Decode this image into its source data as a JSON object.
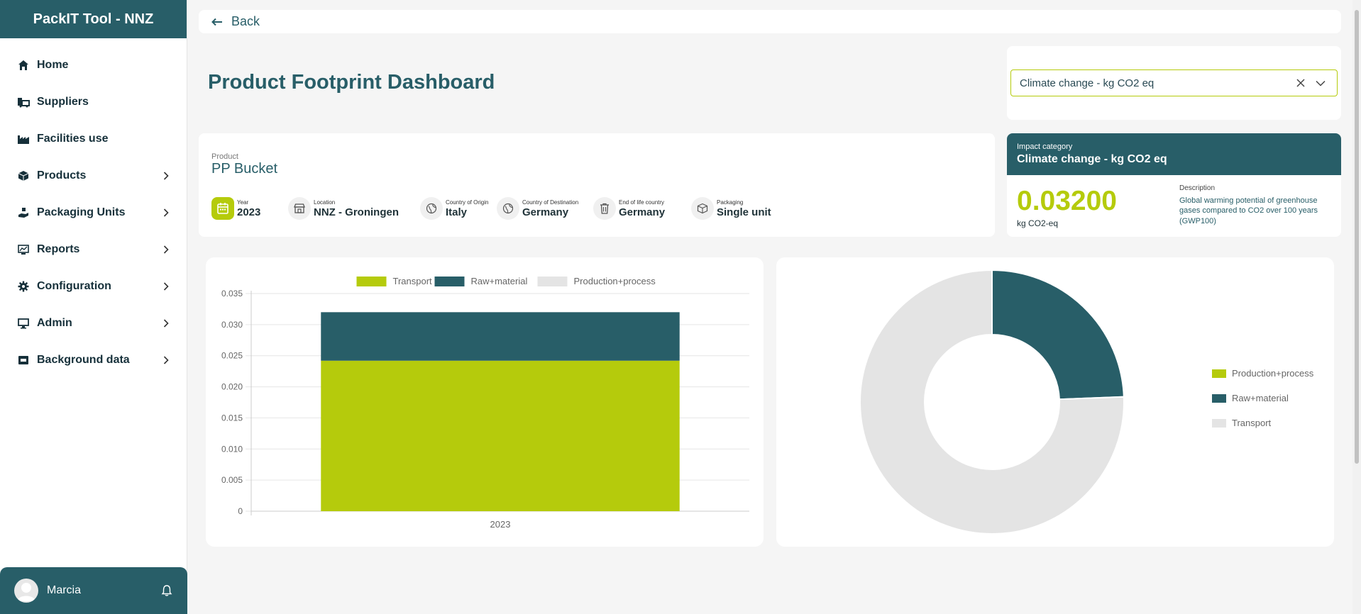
{
  "app": {
    "title": "PackIT Tool - NNZ"
  },
  "sidebar": {
    "items": [
      {
        "label": "Home",
        "icon": "home-icon",
        "expandable": false
      },
      {
        "label": "Suppliers",
        "icon": "truck-icon",
        "expandable": false
      },
      {
        "label": "Facilities use",
        "icon": "factory-icon",
        "expandable": false
      },
      {
        "label": "Products",
        "icon": "cube-icon",
        "expandable": true
      },
      {
        "label": "Packaging Units",
        "icon": "hand-package-icon",
        "expandable": true
      },
      {
        "label": "Reports",
        "icon": "report-icon",
        "expandable": true
      },
      {
        "label": "Configuration",
        "icon": "gear-icon",
        "expandable": true
      },
      {
        "label": "Admin",
        "icon": "monitor-icon",
        "expandable": true
      },
      {
        "label": "Background data",
        "icon": "database-icon",
        "expandable": true
      }
    ],
    "user": {
      "name": "Marcia"
    }
  },
  "back": {
    "label": "Back"
  },
  "page": {
    "title": "Product Footprint Dashboard"
  },
  "selector": {
    "value": "Climate change - kg CO2 eq"
  },
  "product": {
    "small_label": "Product",
    "name": "PP Bucket",
    "attributes": {
      "year": {
        "label": "Year",
        "value": "2023"
      },
      "location": {
        "label": "Location",
        "value": "NNZ - Groningen"
      },
      "origin": {
        "label": "Country of Origin",
        "value": "Italy"
      },
      "destination": {
        "label": "Country of Destination",
        "value": "Germany"
      },
      "eol": {
        "label": "End of life country",
        "value": "Germany"
      },
      "packaging": {
        "label": "Packaging",
        "value": "Single unit"
      }
    }
  },
  "impact": {
    "small_label": "Impact category",
    "title": "Climate change - kg CO2 eq",
    "value": "0.03200",
    "unit": "kg CO2-eq",
    "description_label": "Description",
    "description": "Global warming potential of greenhouse gases compared to CO2 over 100 years (GWP100)"
  },
  "colors": {
    "primary": "#285e68",
    "accent": "#b5cb0c",
    "light_grey": "#e4e4e4"
  },
  "chart_data": [
    {
      "type": "bar",
      "stacked": true,
      "categories": [
        "2023"
      ],
      "series": [
        {
          "name": "Transport",
          "values": [
            0.0242
          ],
          "color": "#b5cb0c"
        },
        {
          "name": "Raw+material",
          "values": [
            0.0078
          ],
          "color": "#285e68"
        },
        {
          "name": "Production+process",
          "values": [
            0
          ],
          "color": "#e4e4e4"
        }
      ],
      "ylim": [
        0,
        0.035
      ],
      "yticks": [
        "0",
        "0.005",
        "0.010",
        "0.015",
        "0.020",
        "0.025",
        "0.030",
        "0.035"
      ],
      "legend": "top",
      "grid": true
    },
    {
      "type": "pie",
      "donut": true,
      "series": [
        {
          "name": "Production+process",
          "value": 0,
          "color": "#b5cb0c"
        },
        {
          "name": "Raw+material",
          "value": 0.0078,
          "color": "#285e68"
        },
        {
          "name": "Transport",
          "value": 0.0242,
          "color": "#e4e4e4"
        }
      ],
      "legend": "right"
    }
  ]
}
